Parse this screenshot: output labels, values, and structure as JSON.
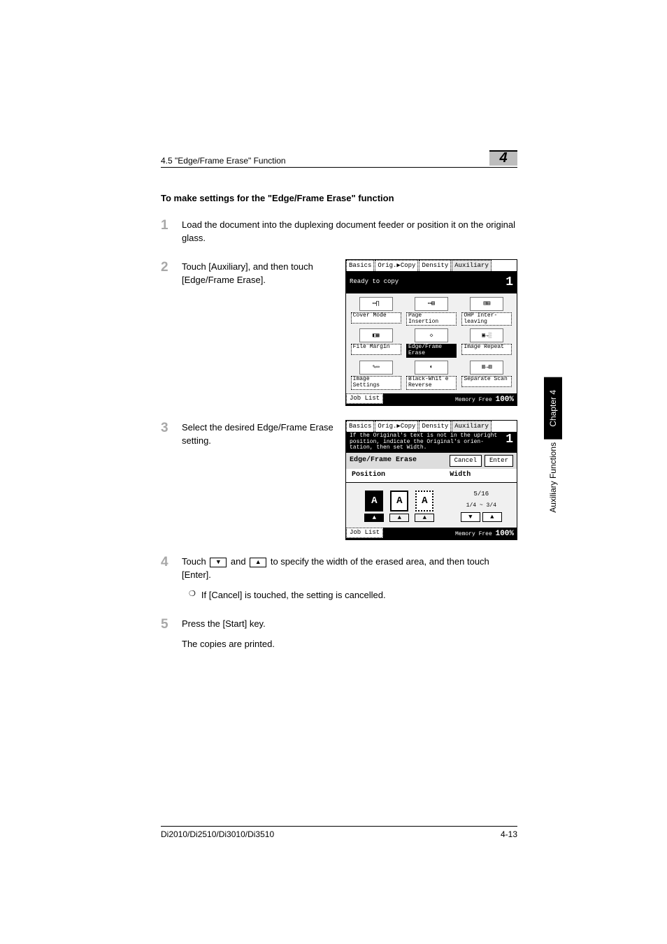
{
  "header": {
    "section_label": "4.5 \"Edge/Frame Erase\" Function",
    "chapter_num": "4"
  },
  "section_title": "To make settings for the \"Edge/Frame Erase\" function",
  "steps": {
    "s1": {
      "num": "1",
      "text": "Load the document into the duplexing document feeder or position it on the original glass."
    },
    "s2": {
      "num": "2",
      "text": "Touch [Auxiliary], and then touch [Edge/Frame Erase]."
    },
    "s3": {
      "num": "3",
      "text": "Select the desired Edge/Frame Erase setting."
    },
    "s4": {
      "num": "4",
      "pre": "Touch ",
      "mid": " and ",
      "post": " to specify the width of the erased area, and then touch [Enter].",
      "sub_bullet": "❍",
      "sub_text": "If [Cancel] is touched, the setting is cancelled."
    },
    "s5": {
      "num": "5",
      "text1": "Press the [Start] key.",
      "text2": "The copies are printed."
    }
  },
  "lcd1": {
    "tabs": [
      "Basics",
      "Orig.▶Copy",
      "Density",
      "Auxiliary"
    ],
    "status": "Ready to copy",
    "count": "1",
    "cells": [
      "Cover Mode",
      "Page\nInsertion",
      "OHP Inter-\nleaving",
      "File\nMargin",
      "Edge/Frame\nErase",
      "Image\nRepeat",
      "Image\nSettings",
      "Black-Whit\ne Reverse",
      "Separate\nScan"
    ],
    "joblist": "Job List",
    "mem_label": "Memory\nFree",
    "mem_val": "100%"
  },
  "lcd2": {
    "tabs": [
      "Basics",
      "Orig.▶Copy",
      "Density",
      "Auxiliary"
    ],
    "msg": "If the Original's text is not\nin the upright position,\nindicate the Original's orien-\ntation, then set Width.",
    "count": "1",
    "efe": "Edge/Frame Erase",
    "cancel": "Cancel",
    "enter": "Enter",
    "position": "Position",
    "width": "Width",
    "width_val": "5/16",
    "width_range": "1/4 ~ 3/4",
    "joblist": "Job List",
    "mem_label": "Memory\nFree",
    "mem_val": "100%"
  },
  "side": {
    "chapter": "Chapter 4",
    "section": "Auxiliary Functions"
  },
  "footer": {
    "left": "Di2010/Di2510/Di3010/Di3510",
    "right": "4-13"
  }
}
